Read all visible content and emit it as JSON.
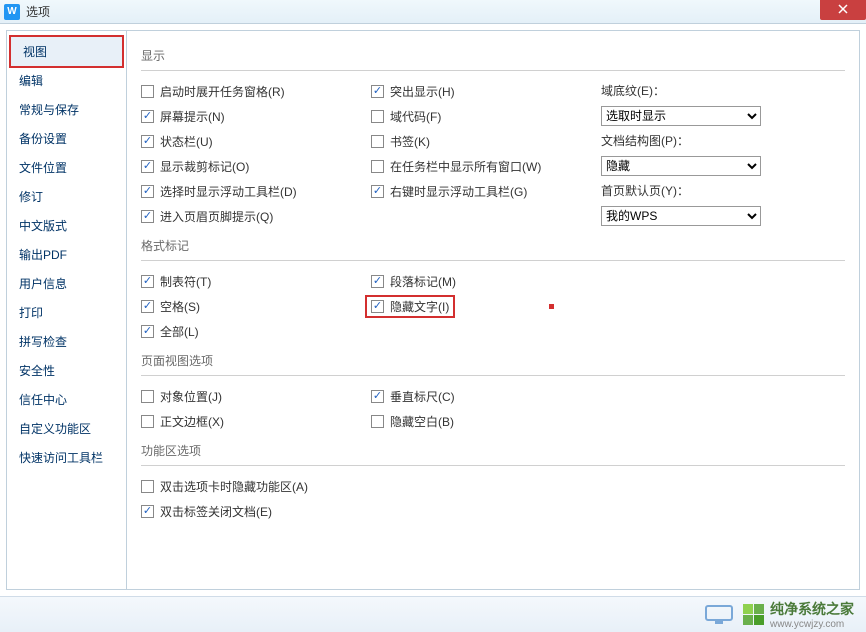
{
  "title": "选项",
  "sidebar": {
    "items": [
      "视图",
      "编辑",
      "常规与保存",
      "备份设置",
      "文件位置",
      "修订",
      "中文版式",
      "输出PDF",
      "用户信息",
      "打印",
      "拼写检查",
      "安全性",
      "信任中心",
      "自定义功能区",
      "快速访问工具栏"
    ],
    "active_index": 0
  },
  "sections": {
    "display": {
      "title": "显示",
      "rows": [
        {
          "c1": {
            "label": "启动时展开任务窗格(R)",
            "checked": false
          },
          "c2": {
            "label": "突出显示(H)",
            "checked": true
          },
          "c3": {
            "kind": "label",
            "text": "域底纹(E)："
          }
        },
        {
          "c1": {
            "label": "屏幕提示(N)",
            "checked": true
          },
          "c2": {
            "label": "域代码(F)",
            "checked": false
          },
          "c3": {
            "kind": "select",
            "value": "选取时显示"
          }
        },
        {
          "c1": {
            "label": "状态栏(U)",
            "checked": true
          },
          "c2": {
            "label": "书签(K)",
            "checked": false
          },
          "c3": {
            "kind": "label",
            "text": "文档结构图(P)："
          }
        },
        {
          "c1": {
            "label": "显示裁剪标记(O)",
            "checked": true
          },
          "c2": {
            "label": "在任务栏中显示所有窗口(W)",
            "checked": false
          },
          "c3": {
            "kind": "select",
            "value": "隐藏"
          }
        },
        {
          "c1": {
            "label": "选择时显示浮动工具栏(D)",
            "checked": true
          },
          "c2": {
            "label": "右键时显示浮动工具栏(G)",
            "checked": true
          },
          "c3": {
            "kind": "label",
            "text": "首页默认页(Y)："
          }
        },
        {
          "c1": {
            "label": "进入页眉页脚提示(Q)",
            "checked": true
          },
          "c2": null,
          "c3": {
            "kind": "select",
            "value": "我的WPS"
          }
        }
      ]
    },
    "format_marks": {
      "title": "格式标记",
      "rows": [
        {
          "c1": {
            "label": "制表符(T)",
            "checked": true
          },
          "c2": {
            "label": "段落标记(M)",
            "checked": true
          }
        },
        {
          "c1": {
            "label": "空格(S)",
            "checked": true
          },
          "c2": {
            "label": "隐藏文字(I)",
            "checked": true,
            "highlighted": true
          }
        },
        {
          "c1": {
            "label": "全部(L)",
            "checked": true
          },
          "c2": null
        }
      ]
    },
    "page_view": {
      "title": "页面视图选项",
      "rows": [
        {
          "c1": {
            "label": "对象位置(J)",
            "checked": false
          },
          "c2": {
            "label": "垂直标尺(C)",
            "checked": true
          }
        },
        {
          "c1": {
            "label": "正文边框(X)",
            "checked": false
          },
          "c2": {
            "label": "隐藏空白(B)",
            "checked": false
          }
        }
      ]
    },
    "ribbon": {
      "title": "功能区选项",
      "rows": [
        {
          "c1": {
            "label": "双击选项卡时隐藏功能区(A)",
            "checked": false
          }
        },
        {
          "c1": {
            "label": "双击标签关闭文档(E)",
            "checked": true
          }
        }
      ]
    }
  },
  "footer": {
    "brand_name": "纯净系统之家",
    "brand_url": "www.ycwjzy.com"
  }
}
